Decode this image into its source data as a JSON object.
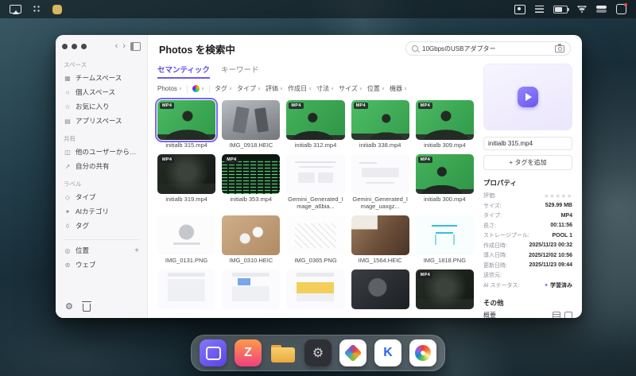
{
  "menubar": {
    "left_icons": [
      "screen-mirroring-icon",
      "dots-grid-icon",
      "app-blob-icon"
    ],
    "right_icons": [
      "capture-icon",
      "list-icon",
      "battery-icon",
      "wifi-icon",
      "control-center-icon",
      "notification-icon"
    ]
  },
  "window": {
    "titlebar": {
      "back": "‹",
      "forward": "›"
    },
    "sidebar": {
      "sections": [
        {
          "title": "スペース",
          "items": [
            {
              "key": "team-space",
              "label": "チームスペース"
            },
            {
              "key": "personal-space",
              "label": "個人スペース"
            },
            {
              "key": "favorites",
              "label": "お気に入り"
            },
            {
              "key": "app-space",
              "label": "アプリスペース"
            }
          ]
        },
        {
          "title": "共有",
          "items": [
            {
              "key": "shared-from-others",
              "label": "他のユーザーから共有"
            },
            {
              "key": "my-shares",
              "label": "自分の共有"
            }
          ]
        },
        {
          "title": "ラベル",
          "items": [
            {
              "key": "type-label",
              "label": "タイプ"
            },
            {
              "key": "ai-category",
              "label": "AIカテゴリ"
            },
            {
              "key": "tags",
              "label": "タグ"
            }
          ]
        }
      ],
      "footer_items": [
        {
          "key": "location",
          "label": "位置",
          "action": "+"
        },
        {
          "key": "web",
          "label": "ウェブ"
        }
      ]
    },
    "header": {
      "title": "Photos を検索中",
      "search_value": "10GbpsのUSBアダプター"
    },
    "tabs": [
      {
        "key": "semantic",
        "label": "セマンティック",
        "active": true
      },
      {
        "key": "keyword",
        "label": "キーワード",
        "active": false
      }
    ],
    "filters": [
      {
        "key": "photos",
        "label": "Photos",
        "divider_after": true
      },
      {
        "key": "color",
        "icon": "color-wheel-icon",
        "divider_after": true
      },
      {
        "key": "tag",
        "label": "タグ"
      },
      {
        "key": "type",
        "label": "タイプ"
      },
      {
        "key": "rating",
        "label": "評価"
      },
      {
        "key": "created",
        "label": "作成日"
      },
      {
        "key": "dimensions",
        "label": "寸法"
      },
      {
        "key": "size",
        "label": "サイズ"
      },
      {
        "key": "location",
        "label": "位置"
      },
      {
        "key": "device",
        "label": "機器"
      }
    ],
    "grid": {
      "items": [
        {
          "name": "initialb 315.mp4",
          "badge": "MP4",
          "thumb": "greenscreen-a",
          "selected": true
        },
        {
          "name": "IMG_0918.HEIC",
          "thumb": "device-gray"
        },
        {
          "name": "initialb 312.mp4",
          "badge": "MP4",
          "thumb": "greenscreen-b"
        },
        {
          "name": "initialb 338.mp4",
          "badge": "MP4",
          "thumb": "greenscreen-c"
        },
        {
          "name": "initialb 309.mp4",
          "badge": "MP4",
          "thumb": "greenscreen-a"
        },
        {
          "name": "initialb 319.mp4",
          "badge": "MP4",
          "thumb": "dark-scene"
        },
        {
          "name": "initialb 353.mp4",
          "badge": "MP4",
          "thumb": "terminal-green"
        },
        {
          "name": "Gemini_Generated_Image_a6bia...",
          "thumb": "diagram-white"
        },
        {
          "name": "Gemini_Generated_Image_uaxgz...",
          "thumb": "diagram-white-2"
        },
        {
          "name": "initialb 300.mp4",
          "badge": "MP4",
          "thumb": "greenscreen-b"
        },
        {
          "name": "IMG_0131.PNG",
          "thumb": "product-white"
        },
        {
          "name": "IMG_0310.HEIC",
          "thumb": "earbuds-wood"
        },
        {
          "name": "IMG_0365.PNG",
          "thumb": "sketch-white"
        },
        {
          "name": "IMG_1564.HEIC",
          "thumb": "photo-warm"
        },
        {
          "name": "IMG_1818.PNG",
          "thumb": "cyan-sketch"
        },
        {
          "name": "",
          "thumb": "phone-shot"
        },
        {
          "name": "",
          "thumb": "phone-shot-2"
        },
        {
          "name": "",
          "thumb": "phone-shot-yellow"
        },
        {
          "name": "",
          "thumb": "dark-object"
        },
        {
          "name": "",
          "badge": "MP4",
          "thumb": "dark-scene"
        }
      ]
    },
    "details": {
      "filename": "initialb 315.mp4",
      "add_tag_label": "+ タグを追加",
      "properties_title": "プロパティ",
      "rating": {
        "label": "評価:",
        "stars": "★★★★★"
      },
      "properties": [
        {
          "label": "サイズ:",
          "value": "529.99 MB"
        },
        {
          "label": "タイプ:",
          "value": "MP4"
        },
        {
          "label": "長さ:",
          "value": "00:11:56"
        },
        {
          "label": "ストレージプール:",
          "value": "POOL 1"
        },
        {
          "label": "作成日時:",
          "value": "2025/11/23 00:32"
        },
        {
          "label": "導入日時:",
          "value": "2025/12/02 10:56"
        },
        {
          "label": "更新日時:",
          "value": "2025/11/23 09:44"
        },
        {
          "label": "送信元:",
          "value": ""
        }
      ],
      "ai_status": {
        "label": "AI ステータス:",
        "value": "学習済み"
      },
      "others_title": "その他",
      "summary_label": "概要"
    }
  },
  "dock": {
    "apps": [
      {
        "name": "nas-manager",
        "style": "purple"
      },
      {
        "name": "z-app",
        "style": "zgrad",
        "glyph": "Z"
      },
      {
        "name": "files",
        "style": "folder"
      },
      {
        "name": "settings",
        "style": "gear",
        "glyph": "⚙"
      },
      {
        "name": "office-suite",
        "style": "diamond"
      },
      {
        "name": "k-app",
        "style": "kblue",
        "glyph": "K"
      },
      {
        "name": "photos",
        "style": "flower"
      }
    ]
  }
}
